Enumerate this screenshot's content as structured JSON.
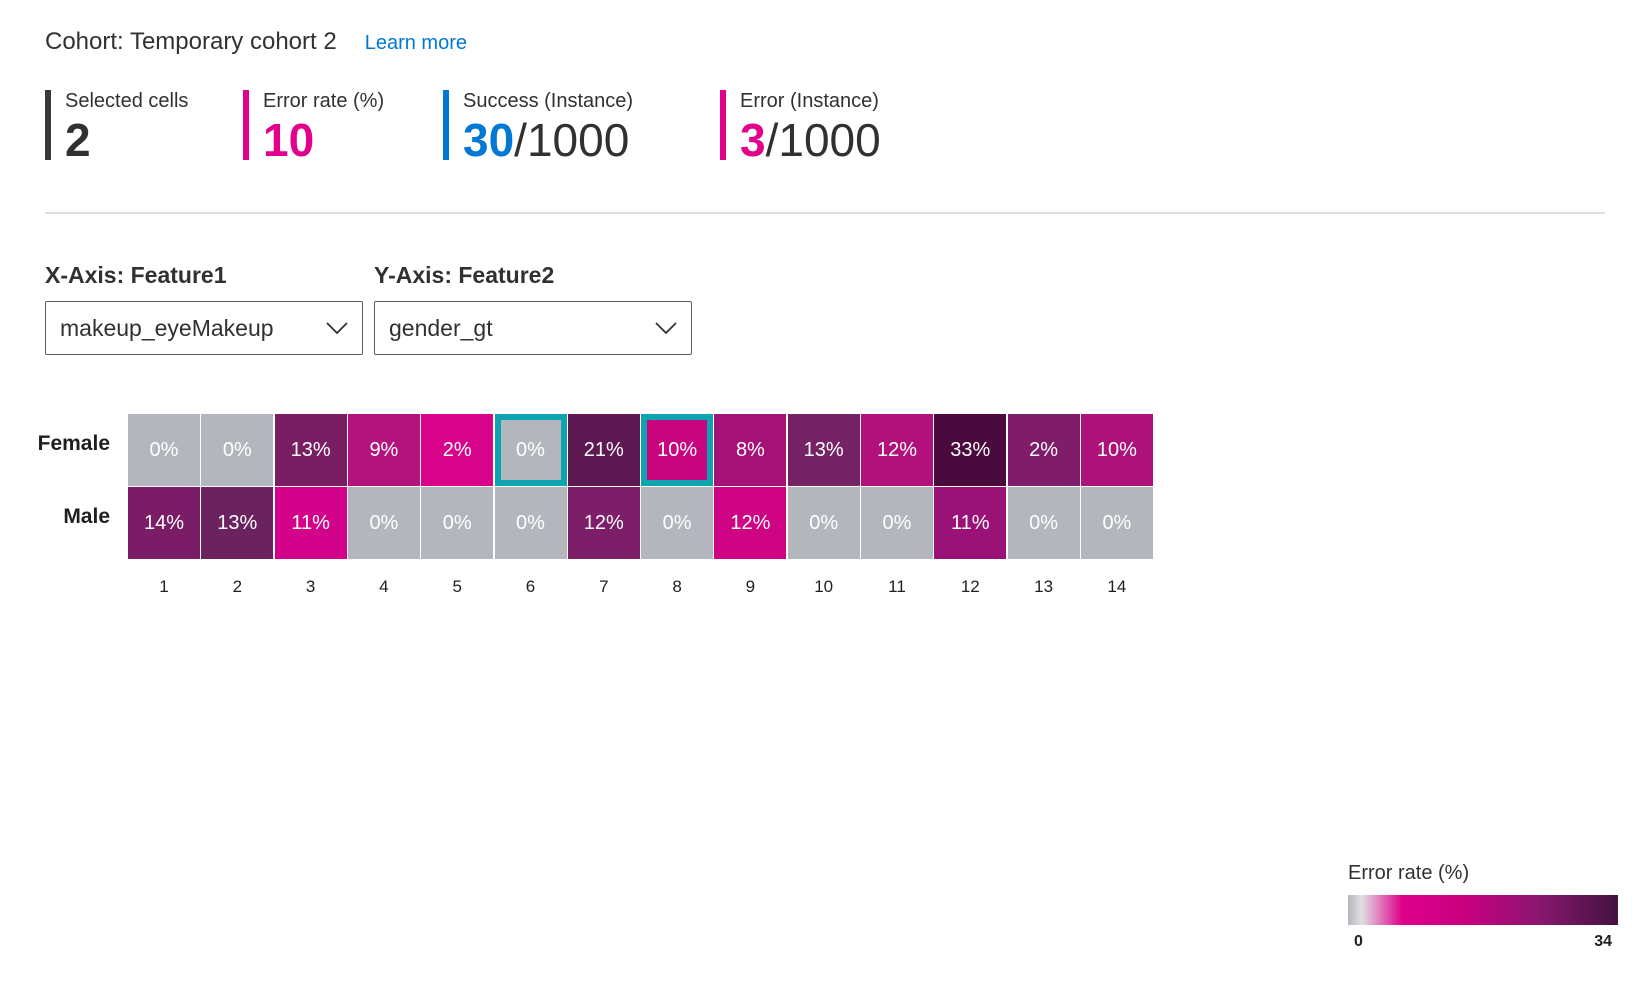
{
  "cohort": {
    "title": "Cohort: Temporary cohort 2",
    "learn_more": "Learn more"
  },
  "metrics": [
    {
      "label": "Selected cells",
      "value": "2",
      "denom": "",
      "bar_color": "#3b3a39",
      "value_color": "#323130"
    },
    {
      "label": "Error rate (%)",
      "value": "10",
      "denom": "",
      "bar_color": "#e3008c",
      "value_color": "#e3008c"
    },
    {
      "label": "Success (Instance)",
      "value": "30",
      "denom": "/1000",
      "bar_color": "#0078d4",
      "value_color": "#0078d4"
    },
    {
      "label": "Error (Instance)",
      "value": "3",
      "denom": "/1000",
      "bar_color": "#e3008c",
      "value_color": "#e3008c"
    }
  ],
  "x_axis": {
    "label": "X-Axis: Feature1",
    "value": "makeup_eyeMakeup"
  },
  "y_axis": {
    "label": "Y-Axis: Feature2",
    "value": "gender_gt"
  },
  "chart_data": {
    "type": "heatmap",
    "columns": [
      "1",
      "2",
      "3",
      "4",
      "5",
      "6",
      "7",
      "8",
      "9",
      "10",
      "11",
      "12",
      "13",
      "14"
    ],
    "rows": [
      {
        "label": "Female",
        "values": [
          0,
          0,
          13,
          9,
          2,
          0,
          21,
          10,
          8,
          13,
          12,
          33,
          2,
          10
        ],
        "display": [
          "0%",
          "0%",
          "13%",
          "9%",
          "2%",
          "0%",
          "21%",
          "10%",
          "8%",
          "13%",
          "12%",
          "33%",
          "2%",
          "10%"
        ],
        "colors": [
          "#b3b7bd",
          "#b3b7bd",
          "#7a1e64",
          "#b4137e",
          "#d8048a",
          "#b3b7bd",
          "#5e1852",
          "#c8057f",
          "#a41277",
          "#762366",
          "#b2117c",
          "#4a0a3e",
          "#7f1d6a",
          "#ad127b"
        ]
      },
      {
        "label": "Male",
        "values": [
          14,
          13,
          11,
          0,
          0,
          0,
          12,
          0,
          12,
          0,
          0,
          11,
          0,
          0
        ],
        "display": [
          "14%",
          "13%",
          "11%",
          "0%",
          "0%",
          "0%",
          "12%",
          "0%",
          "12%",
          "0%",
          "0%",
          "11%",
          "0%",
          "0%"
        ],
        "colors": [
          "#7a1d66",
          "#6b2360",
          "#d2038a",
          "#b3b7bd",
          "#b3b7bd",
          "#b3b7bd",
          "#7c1e68",
          "#b3b7bd",
          "#cf0485",
          "#b3b7bd",
          "#b3b7bd",
          "#9a1278",
          "#b3b7bd",
          "#b3b7bd"
        ]
      }
    ],
    "selected_cells": [
      {
        "row": 0,
        "col": 5
      },
      {
        "row": 0,
        "col": 7
      }
    ],
    "legend": {
      "title": "Error rate (%)",
      "min": "0",
      "max": "34"
    }
  }
}
